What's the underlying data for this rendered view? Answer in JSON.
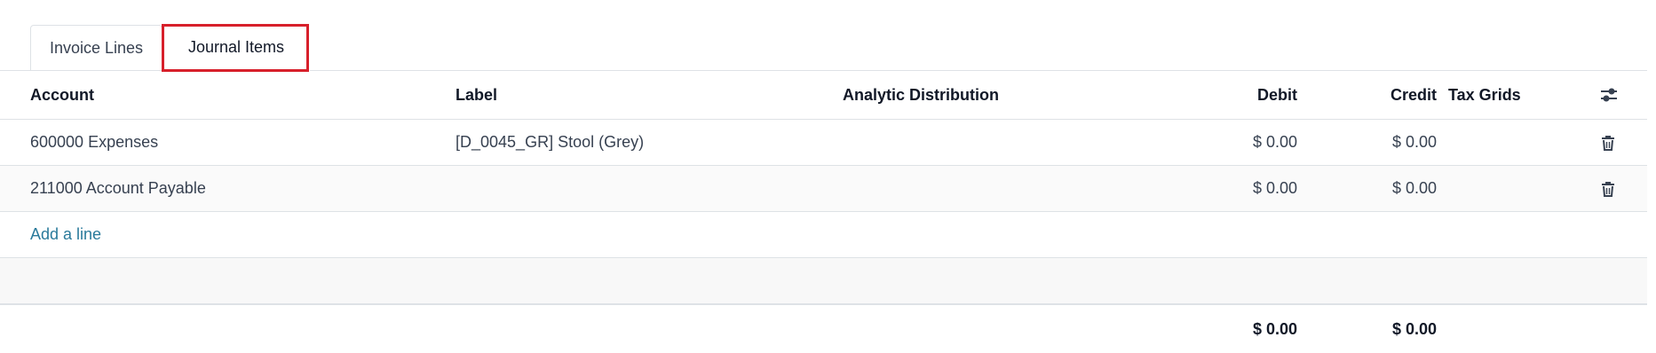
{
  "tabs": [
    {
      "label": "Invoice Lines",
      "active": false
    },
    {
      "label": "Journal Items",
      "active": true
    }
  ],
  "highlight_color": "#d7202b",
  "columns": {
    "account": "Account",
    "label": "Label",
    "analytic": "Analytic Distribution",
    "debit": "Debit",
    "credit": "Credit",
    "tax_grids": "Tax Grids"
  },
  "rows": [
    {
      "account": "600000 Expenses",
      "label": "[D_0045_GR] Stool (Grey)",
      "analytic": "",
      "debit": "$ 0.00",
      "credit": "$ 0.00",
      "tax_grids": ""
    },
    {
      "account": "211000 Account Payable",
      "label": "",
      "analytic": "",
      "debit": "$ 0.00",
      "credit": "$ 0.00",
      "tax_grids": ""
    }
  ],
  "add_line_label": "Add a line",
  "totals": {
    "debit": "$ 0.00",
    "credit": "$ 0.00"
  },
  "icons": {
    "settings": "optional-columns-icon",
    "delete": "trash-icon"
  }
}
